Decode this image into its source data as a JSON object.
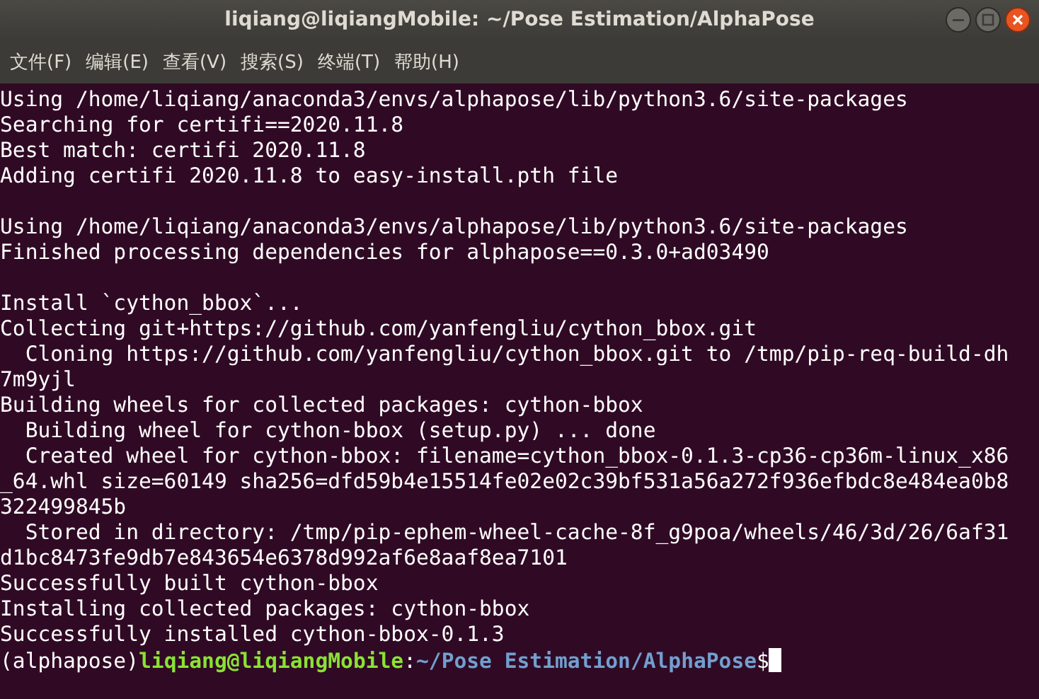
{
  "window": {
    "title": "liqiang@liqiangMobile: ~/Pose Estimation/AlphaPose"
  },
  "menu": [
    "文件(F)",
    "编辑(E)",
    "查看(V)",
    "搜索(S)",
    "终端(T)",
    "帮助(H)"
  ],
  "terminal": {
    "lines": [
      {
        "kind": "output",
        "text": "Using /home/liqiang/anaconda3/envs/alphapose/lib/python3.6/site-packages"
      },
      {
        "kind": "output",
        "text": "Searching for certifi==2020.11.8"
      },
      {
        "kind": "output",
        "text": "Best match: certifi 2020.11.8"
      },
      {
        "kind": "output",
        "text": "Adding certifi 2020.11.8 to easy-install.pth file"
      },
      {
        "kind": "blank"
      },
      {
        "kind": "output",
        "text": "Using /home/liqiang/anaconda3/envs/alphapose/lib/python3.6/site-packages"
      },
      {
        "kind": "output",
        "text": "Finished processing dependencies for alphapose==0.3.0+ad03490"
      },
      {
        "kind": "blank"
      },
      {
        "kind": "output",
        "text": "Install `cython_bbox`..."
      },
      {
        "kind": "output",
        "text": "Collecting git+https://github.com/yanfengliu/cython_bbox.git"
      },
      {
        "kind": "output",
        "text": "  Cloning https://github.com/yanfengliu/cython_bbox.git to /tmp/pip-req-build-dh"
      },
      {
        "kind": "output",
        "text": "7m9yjl"
      },
      {
        "kind": "output",
        "text": "Building wheels for collected packages: cython-bbox"
      },
      {
        "kind": "output",
        "text": "  Building wheel for cython-bbox (setup.py) ... done"
      },
      {
        "kind": "output",
        "text": "  Created wheel for cython-bbox: filename=cython_bbox-0.1.3-cp36-cp36m-linux_x86"
      },
      {
        "kind": "output",
        "text": "_64.whl size=60149 sha256=dfd59b4e15514fe02e02c39bf531a56a272f936efbdc8e484ea0b8"
      },
      {
        "kind": "output",
        "text": "322499845b"
      },
      {
        "kind": "output",
        "text": "  Stored in directory: /tmp/pip-ephem-wheel-cache-8f_g9poa/wheels/46/3d/26/6af31"
      },
      {
        "kind": "output",
        "text": "d1bc8473fe9db7e843654e6378d992af6e8aaf8ea7101"
      },
      {
        "kind": "output",
        "text": "Successfully built cython-bbox"
      },
      {
        "kind": "output",
        "text": "Installing collected packages: cython-bbox"
      },
      {
        "kind": "output",
        "text": "Successfully installed cython-bbox-0.1.3"
      },
      {
        "kind": "prompt",
        "env": "(alphapose)",
        "user": "liqiang@liqiangMobile",
        "sep": ":",
        "path": "~/Pose Estimation/AlphaPose",
        "symbol": "$"
      }
    ]
  }
}
